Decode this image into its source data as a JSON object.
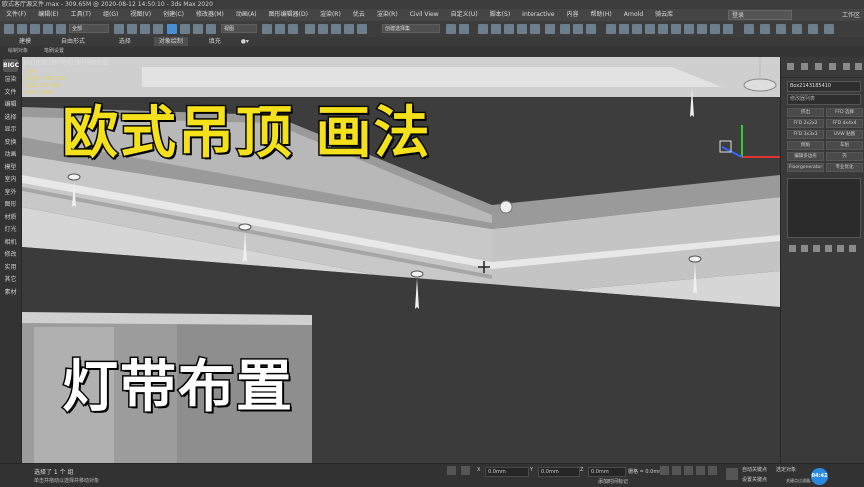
{
  "window": {
    "title": "欧式客厅源文件.max - 309.65M @ 2020-08-12 14:50:10 - 3ds Max 2020"
  },
  "menu": {
    "items": [
      "文件(F)",
      "编辑(E)",
      "工具(T)",
      "组(G)",
      "视图(V)",
      "创建(C)",
      "修改器(M)",
      "动画(A)",
      "图形编辑器(D)",
      "渲染(R)",
      "优云",
      "渲染(R)",
      "Civil View",
      "自定义(U)",
      "脚本(S)",
      "Interactive",
      "内容",
      "帮助(H)",
      "Arnold",
      "骑云库"
    ],
    "login_label": "登录",
    "workspace_label": "工作区"
  },
  "toolbar": {
    "filter_dropdown": "全部",
    "view_dropdown": "视图",
    "selection_set_dropdown": "创建选择集"
  },
  "ribbon": {
    "items": [
      "建模",
      "自由形式",
      "选择",
      "对象绘制",
      "填充"
    ],
    "sub_items": [
      "绘制对象",
      "笔刷设置"
    ]
  },
  "left_panel": {
    "logo": "BIGC",
    "items": [
      "渲染",
      "文件",
      "编辑",
      "选择",
      "显示",
      "变换",
      "动画",
      "模型",
      "室内",
      "室外",
      "图形",
      "材质",
      "灯光",
      "相机",
      "修改",
      "实用",
      "其它",
      "素材"
    ]
  },
  "viewport": {
    "label": "[+] [正交] [用户定义] [默认明暗处理]",
    "stats_lines": [
      "总计",
      "多边形: 467,759",
      "顶点: 357,584",
      "FPS: 2.060"
    ]
  },
  "overlay": {
    "title": "欧式吊顶 画法",
    "subtitle": "灯带布置"
  },
  "right_panel": {
    "object_name": "Box2143185410",
    "modifier_list": "修改器列表",
    "buttons": [
      "挤出",
      "FFD 选择",
      "FFD 2x2x2",
      "FFD 4x4x4",
      "FFD 3x3x3",
      "UVW 贴图",
      "倒角",
      "车削",
      "编辑多边形",
      "壳",
      "Floorgenerator",
      "专业优化"
    ]
  },
  "status": {
    "selected": "选择了 1 个 组",
    "hint": "单击并拖动以选择并移动对象",
    "x_value": "0.0mm",
    "y_value": "0.0mm",
    "z_value": "0.0mm",
    "grid_label": "栅格 = 0.0mm",
    "add_time_tag": "添加时间标记",
    "auto_key": "自动关键点",
    "select_object": "选定对象",
    "set_key": "设置关键点",
    "key_filter": "关键点过滤器...",
    "time_display": "04:42"
  }
}
